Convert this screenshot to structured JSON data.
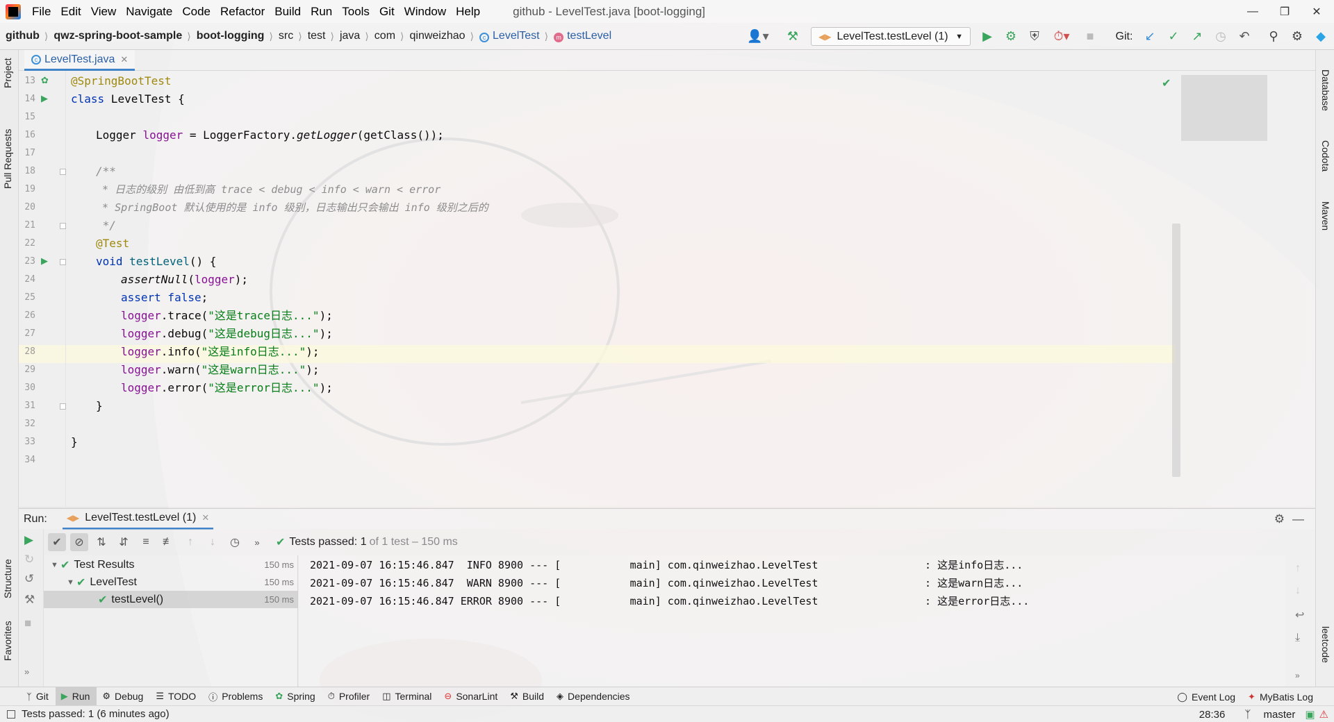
{
  "menubar": {
    "items": [
      "File",
      "Edit",
      "View",
      "Navigate",
      "Code",
      "Refactor",
      "Build",
      "Run",
      "Tools",
      "Git",
      "Window",
      "Help"
    ],
    "title": "github - LevelTest.java [boot-logging]"
  },
  "navbar": {
    "crumbs": [
      "github",
      "qwz-spring-boot-sample",
      "boot-logging",
      "src",
      "test",
      "java",
      "com",
      "qinweizhao",
      "LevelTest",
      "testLevel"
    ],
    "run_config": "LevelTest.testLevel (1)",
    "git_label": "Git:"
  },
  "left_strip": {
    "project": "Project",
    "pull_requests": "Pull Requests",
    "structure": "Structure",
    "favorites": "Favorites"
  },
  "right_strip": {
    "database": "Database",
    "codota": "Codota",
    "maven": "Maven",
    "leetcode": "leetcode"
  },
  "editor": {
    "tab_label": "LevelTest.java",
    "line_numbers": [
      "13",
      "14",
      "15",
      "16",
      "17",
      "18",
      "19",
      "20",
      "21",
      "22",
      "23",
      "24",
      "25",
      "26",
      "27",
      "28",
      "29",
      "30",
      "31",
      "32",
      "33",
      "34"
    ],
    "code": {
      "l13_annotation": "@SpringBootTest",
      "l14_kw": "class",
      "l14_rest": " LevelTest {",
      "l16_type": "Logger ",
      "l16_field": "logger",
      "l16_eq": " = LoggerFactory.",
      "l16_method": "getLogger",
      "l16_rest": "(getClass());",
      "l18": "/**",
      "l19": " * 日志的级别 由低到高 trace < debug < info < warn < error",
      "l20": " * SpringBoot 默认使用的是 info 级别，日志输出只会输出 info 级别之后的",
      "l21": " */",
      "l22": "@Test",
      "l23_kw": "void",
      "l23_method": " testLevel",
      "l23_rest": "() {",
      "l24_method": "assertNull",
      "l24_open": "(",
      "l24_field": "logger",
      "l24_close": ");",
      "l25_kw": "assert false",
      "l25_rest": ";",
      "log_calls": [
        {
          "field": "logger",
          "call": ".trace(",
          "str": "\"这是trace日志...\"",
          "end": ");"
        },
        {
          "field": "logger",
          "call": ".debug(",
          "str": "\"这是debug日志...\"",
          "end": ");"
        },
        {
          "field": "logger",
          "call": ".info(",
          "str": "\"这是info日志...\"",
          "end": ");"
        },
        {
          "field": "logger",
          "call": ".warn(",
          "str": "\"这是warn日志...\"",
          "end": ");"
        },
        {
          "field": "logger",
          "call": ".error(",
          "str": "\"这是error日志...\"",
          "end": ");"
        }
      ],
      "l31": "}",
      "l33": "}"
    }
  },
  "run_panel": {
    "label": "Run:",
    "tab": "LevelTest.testLevel (1)",
    "status_prefix": "Tests passed:",
    "status_count": "1",
    "status_suffix": "of 1 test – 150 ms",
    "tree": [
      {
        "label": "Test Results",
        "time": "150 ms"
      },
      {
        "label": "LevelTest",
        "time": "150 ms"
      },
      {
        "label": "testLevel()",
        "time": "150 ms"
      }
    ],
    "console": [
      "2021-09-07 16:15:46.847  INFO 8900 --- [           main] com.qinweizhao.LevelTest                 : 这是info日志...",
      "2021-09-07 16:15:46.847  WARN 8900 --- [           main] com.qinweizhao.LevelTest                 : 这是warn日志...",
      "2021-09-07 16:15:46.847 ERROR 8900 --- [           main] com.qinweizhao.LevelTest                 : 这是error日志..."
    ]
  },
  "bottom_tools": {
    "items": [
      "Git",
      "Run",
      "Debug",
      "TODO",
      "Problems",
      "Spring",
      "Profiler",
      "Terminal",
      "SonarLint",
      "Build",
      "Dependencies"
    ],
    "event_log": "Event Log",
    "mybatis_log": "MyBatis Log"
  },
  "statusbar": {
    "message": "Tests passed: 1 (6 minutes ago)",
    "position": "28:36",
    "branch": "master"
  },
  "colors": {
    "accent": "#4083c9",
    "success": "#3aa55c",
    "keyword": "#0033b3",
    "string": "#067d17"
  }
}
